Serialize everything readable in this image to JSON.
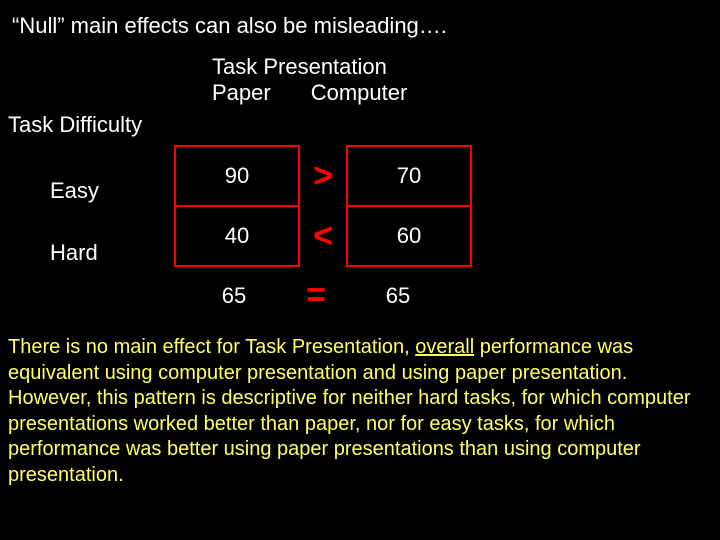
{
  "title": "“Null” main effects can also be misleading….",
  "headers": {
    "presentation": "Task Presentation",
    "paper": "Paper",
    "computer": "Computer",
    "difficulty": "Task Difficulty",
    "easy": "Easy",
    "hard": "Hard"
  },
  "chart_data": {
    "type": "table",
    "row_labels": [
      "Easy",
      "Hard"
    ],
    "col_labels": [
      "Paper",
      "Computer"
    ],
    "cells": [
      [
        90,
        70
      ],
      [
        40,
        60
      ]
    ],
    "row_comparators": [
      ">",
      "<"
    ],
    "col_marginals": [
      65,
      65
    ],
    "marginal_comparator": "="
  },
  "body": {
    "p1a": "There is no main effect for Task Presentation, ",
    "p1_underline": "overall",
    "p1b": " performance was equivalent using computer presentation and using paper presentation.  However, this pattern is descriptive for neither hard tasks, for which computer presentations worked better than paper, nor for easy tasks, for which performance was better using paper presentations than using computer presentation."
  }
}
